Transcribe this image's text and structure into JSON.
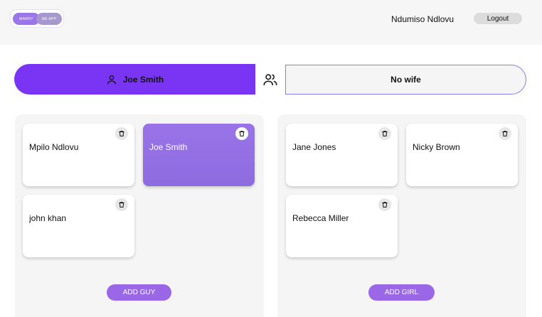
{
  "header": {
    "logo_left": "MARRY",
    "logo_right": "ME APP",
    "username": "Ndumiso Ndlovu",
    "logout_label": "Logout"
  },
  "match": {
    "selected_guy": "Joe Smith",
    "selected_girl": "No wife",
    "user_icon": "user-icon",
    "pair_icon": "users-icon"
  },
  "guys": {
    "cards": [
      {
        "name": "Mpilo Ndlovu",
        "selected": false
      },
      {
        "name": "Joe Smith",
        "selected": true
      },
      {
        "name": "john khan",
        "selected": false
      }
    ],
    "add_label": "ADD GUY"
  },
  "girls": {
    "cards": [
      {
        "name": "Jane Jones",
        "selected": false
      },
      {
        "name": "Nicky Brown",
        "selected": false
      },
      {
        "name": "Rebecca Miller",
        "selected": false
      }
    ],
    "add_label": "ADD GIRL"
  },
  "colors": {
    "accent": "#7a34f4",
    "card_selected": "#9a73e8",
    "button": "#9a68e6",
    "panel_bg": "#f5f5f5"
  }
}
